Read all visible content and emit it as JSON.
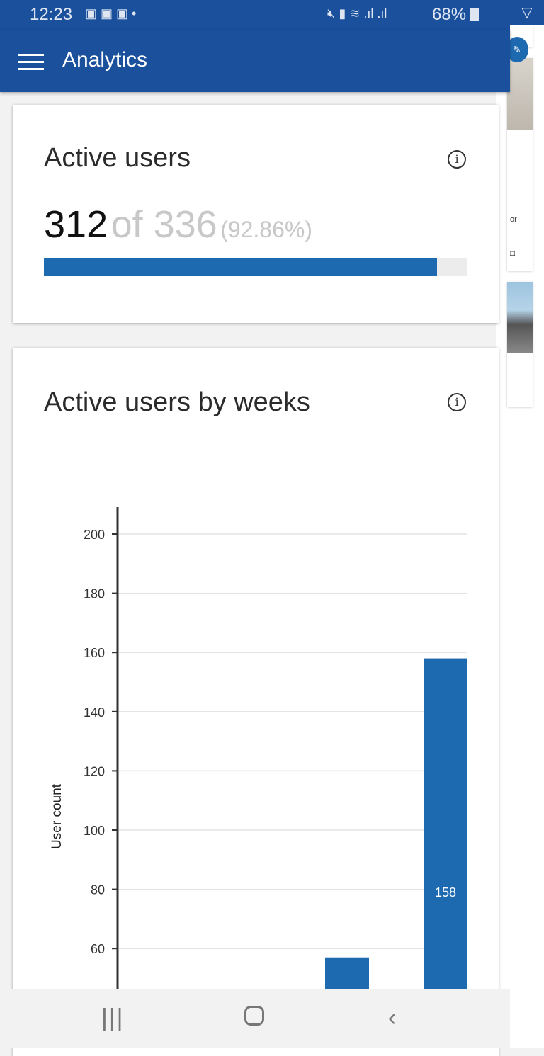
{
  "status_bar": {
    "time": "12:23",
    "battery": "68%"
  },
  "app_bar": {
    "title": "Analytics",
    "menu_icon": "hamburger-icon",
    "filter_icon": "filter-icon"
  },
  "active_users": {
    "title": "Active users",
    "count": "312",
    "of_label": "of 336",
    "percent_label": "(92.86%)",
    "progress": 0.9286,
    "accent": "#1e6ab0"
  },
  "weekly": {
    "title": "Active users by weeks"
  },
  "background_peek": {
    "text": "or"
  },
  "chart_data": {
    "type": "bar",
    "ylabel": "User count",
    "yticks": [
      60,
      80,
      100,
      120,
      140,
      160,
      180,
      200
    ],
    "values": [
      57,
      158
    ],
    "data_labels": [
      "",
      "158"
    ],
    "grid": true,
    "color": "#1e6ab0"
  }
}
